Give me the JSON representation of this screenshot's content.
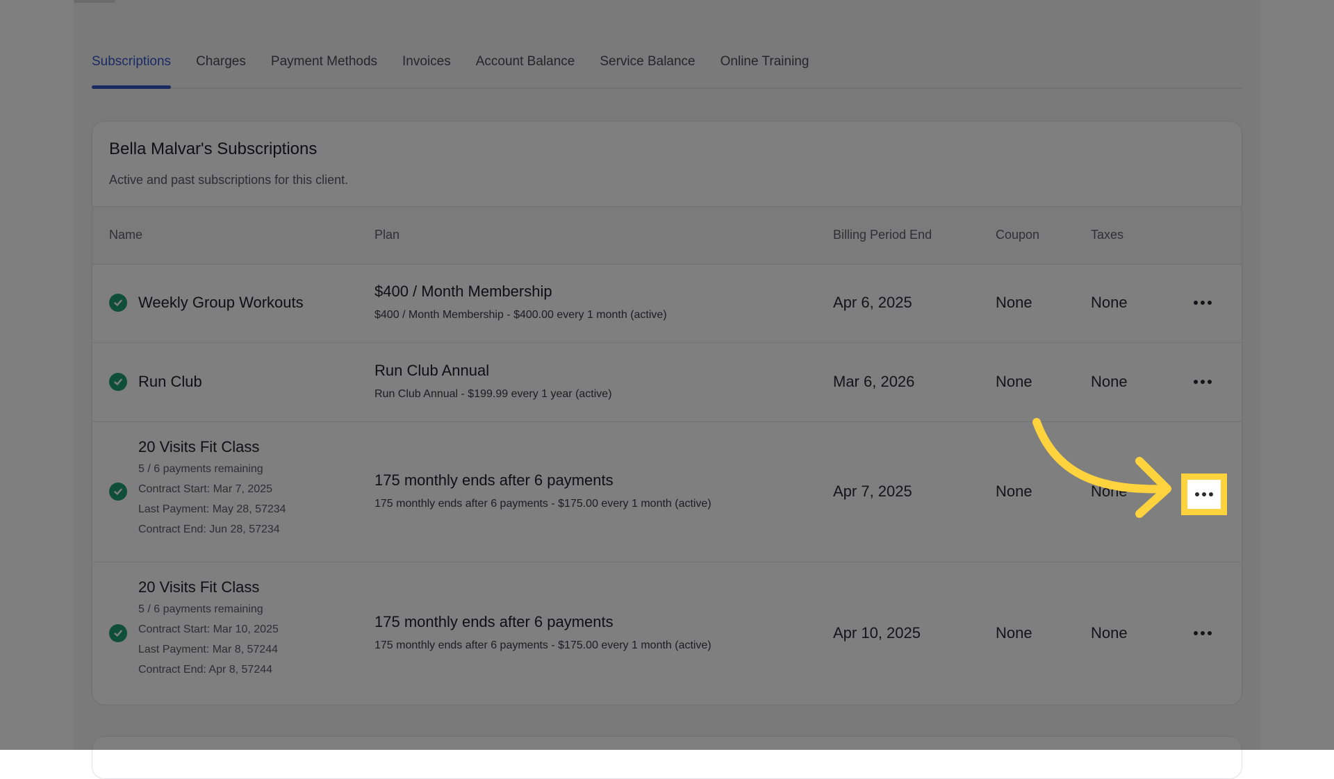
{
  "tabs": [
    {
      "label": "Subscriptions",
      "active": true
    },
    {
      "label": "Charges",
      "active": false
    },
    {
      "label": "Payment Methods",
      "active": false
    },
    {
      "label": "Invoices",
      "active": false
    },
    {
      "label": "Account Balance",
      "active": false
    },
    {
      "label": "Service Balance",
      "active": false
    },
    {
      "label": "Online Training",
      "active": false
    }
  ],
  "card": {
    "title": "Bella Malvar's Subscriptions",
    "subtitle": "Active and past subscriptions for this client."
  },
  "table": {
    "headers": {
      "name": "Name",
      "plan": "Plan",
      "billing_period_end": "Billing Period End",
      "coupon": "Coupon",
      "taxes": "Taxes"
    },
    "rows": [
      {
        "name": "Weekly Group Workouts",
        "meta": [],
        "plan_title": "$400 / Month Membership",
        "plan_sub": "$400 / Month Membership - $400.00 every 1 month (active)",
        "billing_period_end": "Apr 6, 2025",
        "coupon": "None",
        "taxes": "None",
        "status": "active"
      },
      {
        "name": "Run Club",
        "meta": [],
        "plan_title": "Run Club Annual",
        "plan_sub": "Run Club Annual - $199.99 every 1 year (active)",
        "billing_period_end": "Mar 6, 2026",
        "coupon": "None",
        "taxes": "None",
        "status": "active"
      },
      {
        "name": "20 Visits Fit Class",
        "meta": [
          "5 / 6 payments remaining",
          "Contract Start: Mar 7, 2025",
          "Last Payment: May 28, 57234",
          "Contract End: Jun 28, 57234"
        ],
        "plan_title": "175 monthly ends after 6 payments",
        "plan_sub": "175 monthly ends after 6 payments - $175.00 every 1 month (active)",
        "billing_period_end": "Apr 7, 2025",
        "coupon": "None",
        "taxes": "None",
        "status": "active",
        "highlighted": true
      },
      {
        "name": "20 Visits Fit Class",
        "meta": [
          "5 / 6 payments remaining",
          "Contract Start: Mar 10, 2025",
          "Last Payment: Mar 8, 57244",
          "Contract End: Apr 8, 57244"
        ],
        "plan_title": "175 monthly ends after 6 payments",
        "plan_sub": "175 monthly ends after 6 payments - $175.00 every 1 month (active)",
        "billing_period_end": "Apr 10, 2025",
        "coupon": "None",
        "taxes": "None",
        "status": "active"
      }
    ]
  },
  "icons": {
    "status": "check-circle-icon",
    "row_actions": "more-horizontal-icon",
    "callout": "curved-arrow-icon"
  },
  "colors": {
    "accent": "#3557c7",
    "success": "#1e9e74",
    "highlight": "#ffd33d",
    "overlay": "rgba(0,0,0,0.5)"
  }
}
